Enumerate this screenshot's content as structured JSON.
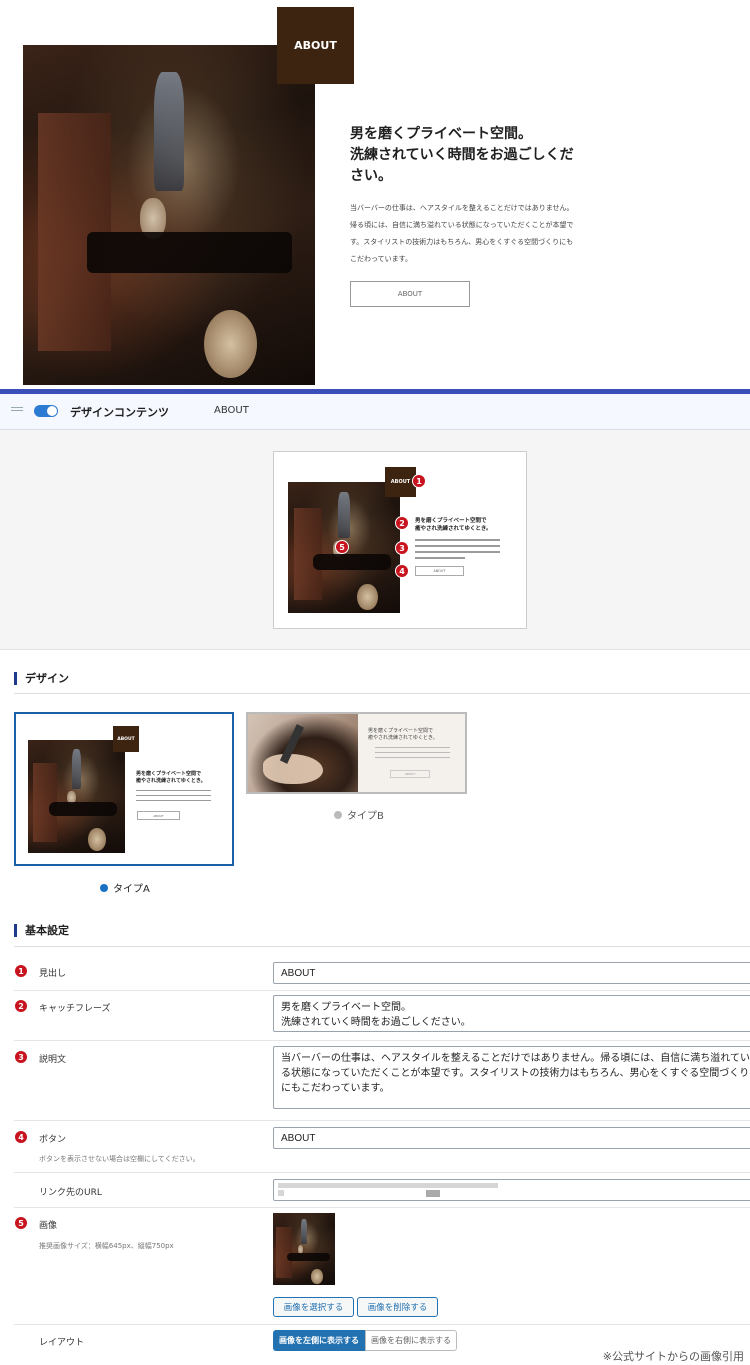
{
  "hero": {
    "badge": "ABOUT",
    "heading": "男を磨くプライベート空間。\n洗練されていく時間をお過ごしください。",
    "description": "当バーバーの仕事は、ヘアスタイルを整えることだけではありません。帰る頃には、自信に満ち溢れている状態になっていただくことが本望です。スタイリストの技術力はもちろん、男心をくすぐる空間づくりにもこだわっています。",
    "button": "ABOUT"
  },
  "editor": {
    "block_title": "デザインコンテンツ",
    "block_subtitle": "ABOUT"
  },
  "preview": {
    "badge": "ABOUT",
    "heading": "男を磨くプライベート空間で\n癒やされ洗練されてゆくとき。",
    "button": "ABOUT",
    "markers": [
      "1",
      "2",
      "3",
      "4",
      "5"
    ]
  },
  "design": {
    "title": "デザイン",
    "typeA": {
      "label": "タイプA",
      "badge": "ABOUT",
      "heading": "男を磨くプライベート空間で\n癒やされ洗練されてゆくとき。",
      "button": "ABOUT"
    },
    "typeB": {
      "label": "タイプB",
      "heading": "男を磨くプライベート空間で\n癒やされ洗練されてゆくとき。",
      "button": "ABOUT"
    }
  },
  "settings": {
    "title": "基本設定",
    "heading": {
      "num": "1",
      "label": "見出し",
      "value": "ABOUT"
    },
    "catchphrase": {
      "num": "2",
      "label": "キャッチフレーズ",
      "value": "男を磨くプライベート空間。\n洗練されていく時間をお過ごしください。"
    },
    "description": {
      "num": "3",
      "label": "説明文",
      "value": "当バーバーの仕事は、ヘアスタイルを整えることだけではありません。帰る頃には、自信に満ち溢れている状態になっていただくことが本望です。スタイリストの技術力はもちろん、男心をくすぐる空間づくりにもこだわっています。"
    },
    "button": {
      "num": "4",
      "label": "ボタン",
      "hint": "ボタンを表示させない場合は空欄にしてください。",
      "value": "ABOUT"
    },
    "url": {
      "label": "リンク先のURL"
    },
    "image": {
      "num": "5",
      "label": "画像",
      "hint": "推奨画像サイズ：横幅645px、縦幅750px",
      "select": "画像を選択する",
      "delete": "画像を削除する"
    },
    "layout": {
      "label": "レイアウト",
      "left": "画像を左側に表示する",
      "right": "画像を右側に表示する"
    }
  },
  "credit": "※公式サイトからの画像引用"
}
